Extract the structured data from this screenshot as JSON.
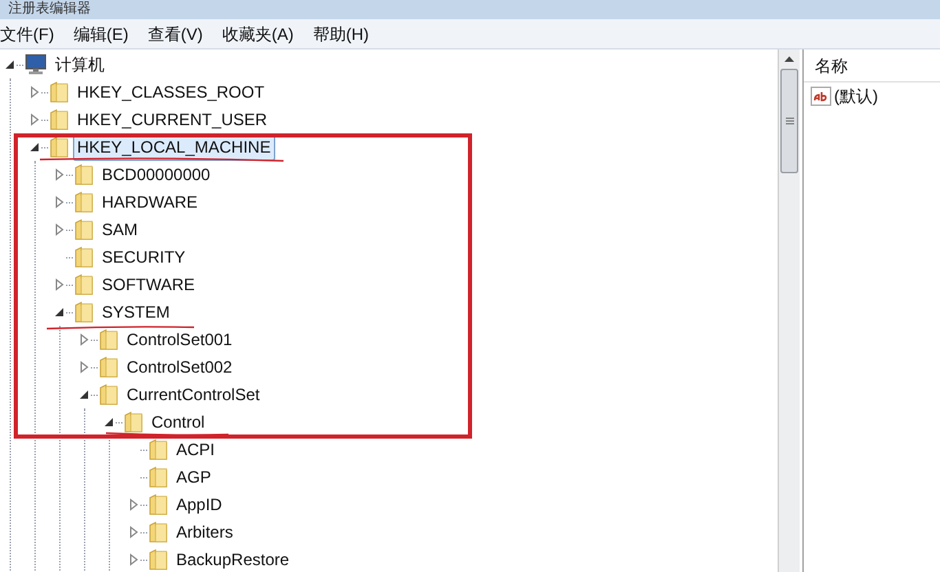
{
  "window": {
    "title": "注册表编辑器"
  },
  "menu": [
    "文件(F)",
    "编辑(E)",
    "查看(V)",
    "收藏夹(A)",
    "帮助(H)"
  ],
  "tree": [
    {
      "label": "计算机",
      "kind": "computer",
      "expanded": true,
      "selected": false,
      "children": [
        {
          "label": "HKEY_CLASSES_ROOT",
          "kind": "branch",
          "expanded": false,
          "selected": false
        },
        {
          "label": "HKEY_CURRENT_USER",
          "kind": "branch",
          "expanded": false,
          "selected": false
        },
        {
          "label": "HKEY_LOCAL_MACHINE",
          "kind": "branch",
          "expanded": true,
          "selected": true,
          "children": [
            {
              "label": "BCD00000000",
              "kind": "branch",
              "expanded": false,
              "selected": false
            },
            {
              "label": "HARDWARE",
              "kind": "branch",
              "expanded": false,
              "selected": false
            },
            {
              "label": "SAM",
              "kind": "branch",
              "expanded": false,
              "selected": false
            },
            {
              "label": "SECURITY",
              "kind": "leaf",
              "selected": false
            },
            {
              "label": "SOFTWARE",
              "kind": "branch",
              "expanded": false,
              "selected": false
            },
            {
              "label": "SYSTEM",
              "kind": "branch",
              "expanded": true,
              "selected": false,
              "children": [
                {
                  "label": "ControlSet001",
                  "kind": "branch",
                  "expanded": false,
                  "selected": false
                },
                {
                  "label": "ControlSet002",
                  "kind": "branch",
                  "expanded": false,
                  "selected": false
                },
                {
                  "label": "CurrentControlSet",
                  "kind": "branch",
                  "expanded": true,
                  "selected": false,
                  "children": [
                    {
                      "label": "Control",
                      "kind": "branch",
                      "expanded": true,
                      "selected": false,
                      "children": [
                        {
                          "label": "ACPI",
                          "kind": "leaf",
                          "selected": false
                        },
                        {
                          "label": "AGP",
                          "kind": "leaf",
                          "selected": false
                        },
                        {
                          "label": "AppID",
                          "kind": "branch",
                          "expanded": false,
                          "selected": false
                        },
                        {
                          "label": "Arbiters",
                          "kind": "branch",
                          "expanded": false,
                          "selected": false
                        },
                        {
                          "label": "BackupRestore",
                          "kind": "branch",
                          "expanded": false,
                          "selected": false
                        }
                      ]
                    }
                  ]
                }
              ]
            }
          ]
        }
      ]
    }
  ],
  "values": {
    "columns": [
      "名称"
    ],
    "rows": [
      {
        "name": "(默认)"
      }
    ]
  }
}
